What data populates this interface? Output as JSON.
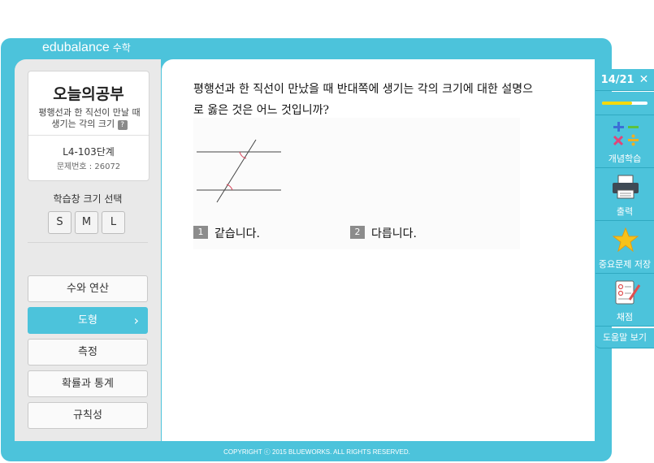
{
  "brand": {
    "name": "edubalance",
    "subject": "수학"
  },
  "today": {
    "title": "오늘의공부",
    "desc": "평행선과 한 직선이 만날 때 생기는 각의 크기",
    "help": "?",
    "level": "L4-103단계",
    "problem_no": "문제번호 : 26072"
  },
  "size_selector": {
    "label": "학습창 크기 선택",
    "options": [
      "S",
      "M",
      "L"
    ]
  },
  "categories": [
    {
      "label": "수와 연산",
      "active": false
    },
    {
      "label": "도형",
      "active": true
    },
    {
      "label": "측정",
      "active": false
    },
    {
      "label": "확률과 통계",
      "active": false
    },
    {
      "label": "규칙성",
      "active": false
    }
  ],
  "question": {
    "text": "평행선과 한 직선이 만났을 때 반대쪽에 생기는 각의 크기에 대한 설명으로 옳은 것은 어느 것입니까?",
    "choices": [
      {
        "num": "1",
        "text": "같습니다."
      },
      {
        "num": "2",
        "text": "다릅니다."
      }
    ]
  },
  "figure_colors": {
    "line": "#444444",
    "angle": "#d9445a"
  },
  "sidebar": {
    "counter": "14/21",
    "close": "✕",
    "progress": 0.667,
    "progress_color": "#f5d90a",
    "items": [
      {
        "label": "개념학습",
        "icon": "math-operators-icon"
      },
      {
        "label": "출력",
        "icon": "printer-icon"
      },
      {
        "label": "중요문제 저장",
        "icon": "star-icon"
      },
      {
        "label": "채점",
        "icon": "grading-sheet-icon"
      }
    ],
    "help": "도움말 보기"
  },
  "footer": "COPYRIGHT ⓒ 2015 BLUEWORKS. ALL RIGHTS RESERVED.",
  "colors": {
    "accent": "#4cc3db",
    "panel": "#e9e9e9"
  }
}
